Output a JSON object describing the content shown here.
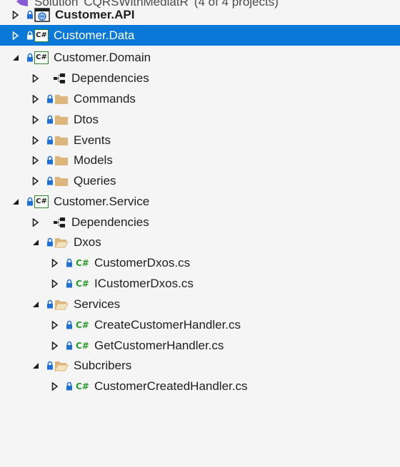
{
  "solution_header": "Solution 'CQRSWithMediatR' (4 of 4 projects)",
  "colors": {
    "selection": "#0a78d7",
    "folder": "#dcb67a",
    "csharp_green": "#2a9b2a",
    "lock_blue": "#1e6fd6"
  },
  "tree": {
    "customer_api": "Customer.API",
    "customer_data": "Customer.Data",
    "customer_domain": "Customer.Domain",
    "domain_dependencies": "Dependencies",
    "commands": "Commands",
    "dtos": "Dtos",
    "events": "Events",
    "models": "Models",
    "queries": "Queries",
    "customer_service": "Customer.Service",
    "service_dependencies": "Dependencies",
    "dxos": "Dxos",
    "customer_dxos_cs": "CustomerDxos.cs",
    "icustomer_dxos_cs": "ICustomerDxos.cs",
    "services": "Services",
    "create_customer_handler_cs": "CreateCustomerHandler.cs",
    "get_customer_handler_cs": "GetCustomerHandler.cs",
    "subcribers": "Subcribers",
    "customer_created_handler_cs": "CustomerCreatedHandler.cs"
  },
  "icons": {
    "csharp_badge": "C#",
    "csharp_file": "C#"
  }
}
